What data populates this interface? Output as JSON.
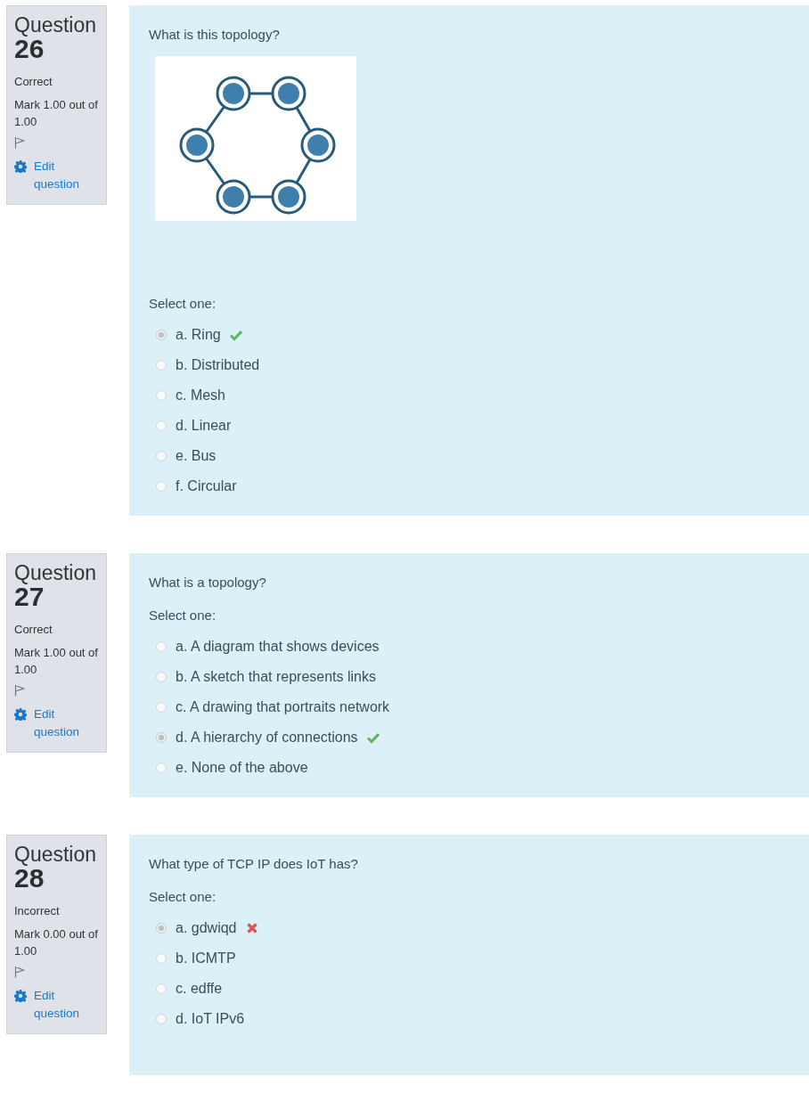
{
  "questions": [
    {
      "title": "Question",
      "number": "26",
      "status": "Correct",
      "mark": "Mark 1.00 out of 1.00",
      "edit_link": "Edit question",
      "text": "What is this topology?",
      "figure": {
        "kind": "ring-diagram"
      },
      "prompt": "Select one:",
      "options": [
        {
          "label": "a. Ring",
          "selected": true,
          "kind": "correct"
        },
        {
          "label": "b. Distributed",
          "selected": false
        },
        {
          "label": "c. Mesh",
          "selected": false
        },
        {
          "label": "d. Linear",
          "selected": false
        },
        {
          "label": "e. Bus",
          "selected": false
        },
        {
          "label": "f. Circular",
          "selected": false
        }
      ]
    },
    {
      "title": "Question",
      "number": "27",
      "status": "Correct",
      "mark": "Mark 1.00 out of 1.00",
      "edit_link": "Edit question",
      "text": "What is a topology?",
      "prompt": "Select one:",
      "options": [
        {
          "label": "a. A diagram that shows devices",
          "selected": false
        },
        {
          "label": "b. A sketch that represents links",
          "selected": false
        },
        {
          "label": "c. A drawing that portraits network",
          "selected": false
        },
        {
          "label": "d. A hierarchy of connections",
          "selected": true,
          "kind": "correct"
        },
        {
          "label": "e. None of the above",
          "selected": false
        }
      ]
    },
    {
      "title": "Question",
      "number": "28",
      "status": "Incorrect",
      "mark": "Mark 0.00 out of 1.00",
      "edit_link": "Edit question",
      "text": "What type of TCP IP does IoT has?",
      "prompt": "Select one:",
      "options": [
        {
          "label": "a. gdwiqd",
          "selected": true,
          "kind": "incorrect"
        },
        {
          "label": "b. ICMTP",
          "selected": false
        },
        {
          "label": "c. edffe",
          "selected": false
        },
        {
          "label": "d. IoT IPv6",
          "selected": false
        }
      ]
    }
  ]
}
